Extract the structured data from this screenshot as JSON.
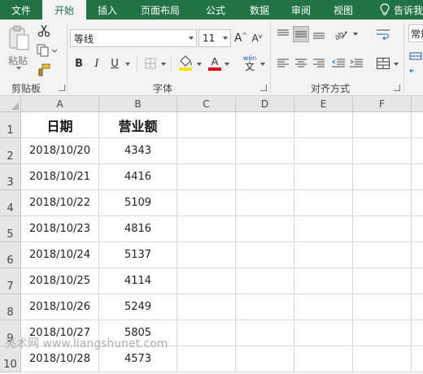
{
  "tabs": [
    {
      "id": "file",
      "label": "文件",
      "active": false
    },
    {
      "id": "home",
      "label": "开始",
      "active": true
    },
    {
      "id": "insert",
      "label": "插入",
      "active": false
    },
    {
      "id": "layout",
      "label": "页面布局",
      "active": false
    },
    {
      "id": "formula",
      "label": "公式",
      "active": false
    },
    {
      "id": "data",
      "label": "数据",
      "active": false
    },
    {
      "id": "review",
      "label": "审阅",
      "active": false
    },
    {
      "id": "view",
      "label": "视图",
      "active": false
    }
  ],
  "tell_me": "告诉我",
  "ribbon": {
    "clipboard": {
      "paste_label": "粘贴",
      "group_label": "剪贴板"
    },
    "font": {
      "font_name": "等线",
      "font_size": "11",
      "group_label": "字体",
      "bold": "B",
      "italic": "I",
      "underline": "U",
      "wen": "wén",
      "wen_char": "文"
    },
    "alignment": {
      "group_label": "对齐方式"
    },
    "styles": {
      "style_box": "常规"
    }
  },
  "colors": {
    "accent": "#217346",
    "fill_yellow": "#ffe600",
    "font_red": "#e00000"
  },
  "sheet": {
    "columns": [
      "A",
      "B",
      "C",
      "D",
      "E",
      "F"
    ],
    "rows": [
      {
        "num": "1",
        "a": "日期",
        "b": "营业额"
      },
      {
        "num": "2",
        "a": "2018/10/20",
        "b": "4343"
      },
      {
        "num": "3",
        "a": "2018/10/21",
        "b": "4416"
      },
      {
        "num": "4",
        "a": "2018/10/22",
        "b": "5109"
      },
      {
        "num": "5",
        "a": "2018/10/23",
        "b": "4816"
      },
      {
        "num": "6",
        "a": "2018/10/24",
        "b": "5137"
      },
      {
        "num": "7",
        "a": "2018/10/25",
        "b": "4114"
      },
      {
        "num": "8",
        "a": "2018/10/26",
        "b": "5249"
      },
      {
        "num": "9",
        "a": "2018/10/27",
        "b": "5805"
      },
      {
        "num": "10",
        "a": "2018/10/28",
        "b": "4573"
      }
    ]
  },
  "watermark": "亮术网 www.liangshunet.com"
}
